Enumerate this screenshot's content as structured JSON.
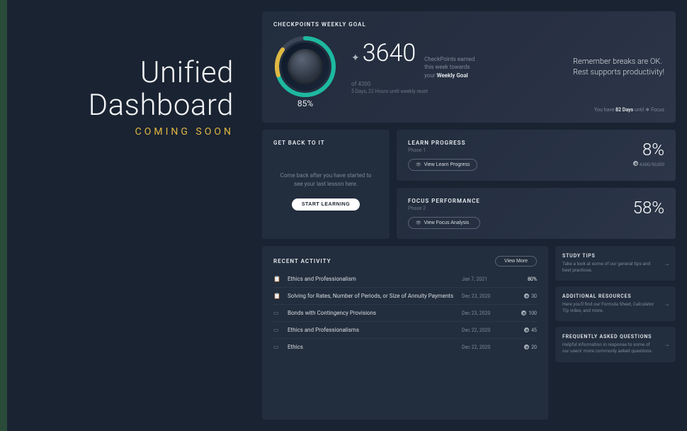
{
  "left": {
    "title_l1": "Unified",
    "title_l2": "Dashboard",
    "subtitle": "COMING SOON"
  },
  "goal": {
    "header": "CHECKPOINTS WEEKLY GOAL",
    "percent": "85%",
    "points": "3640",
    "of_label": "of 4300",
    "desc_l1": "CheckPoints earned",
    "desc_l2": "this week towards",
    "desc_l3_pre": "your ",
    "desc_l3_em": "Weekly Goal",
    "reset": "5 Days, 22 Hours until weekly reset",
    "tip_l1": "Remember breaks are OK.",
    "tip_l2": "Rest supports productivity!",
    "foot_pre": "You have ",
    "foot_em": "82 Days",
    "foot_post": " until ",
    "foot_icon_label": "Focus"
  },
  "back": {
    "header": "GET BACK TO IT",
    "msg": "Come back after you have started to see your last lesson here.",
    "button": "START LEARNING"
  },
  "learn": {
    "header": "LEARN PROGRESS",
    "sub": "Phase 1",
    "button": "View Learn Progress",
    "percent": "8%",
    "detail": "4,000/50,000"
  },
  "focus": {
    "header": "FOCUS PERFORMANCE",
    "sub": "Phase 2",
    "button": "View Focus Analysis",
    "percent": "58%"
  },
  "recent": {
    "header": "RECENT ACTIVITY",
    "more": "View More",
    "rows": [
      {
        "icon": "📋",
        "title": "Ethics and Professionalism",
        "date": "Jan 7, 2021",
        "score": "80%",
        "em": true
      },
      {
        "icon": "📋",
        "title": "Solving for Rates, Number of Periods, or Size of Annuity Payments",
        "date": "Dec 23, 2020",
        "score": "30",
        "em": false
      },
      {
        "icon": "▭",
        "title": "Bonds with Contingency Provisions",
        "date": "Dec 23, 2020",
        "score": "100",
        "em": false
      },
      {
        "icon": "▭",
        "title": "Ethics and Professionalisms",
        "date": "Dec 22, 2020",
        "score": "45",
        "em": false
      },
      {
        "icon": "▭",
        "title": "Ethics",
        "date": "Dec 22, 2020",
        "score": "20",
        "em": false
      }
    ]
  },
  "side": [
    {
      "h": "STUDY TIPS",
      "p": "Take a look at some of our general tips and best practices."
    },
    {
      "h": "ADDITIONAL RESOURCES",
      "p": "Here you'll find our Formula Sheet, Calculator Tip video, and more."
    },
    {
      "h": "FREQUENTLY ASKED QUESTIONS",
      "p": "Helpful information in response to some of our users' more commonly asked questions."
    }
  ]
}
